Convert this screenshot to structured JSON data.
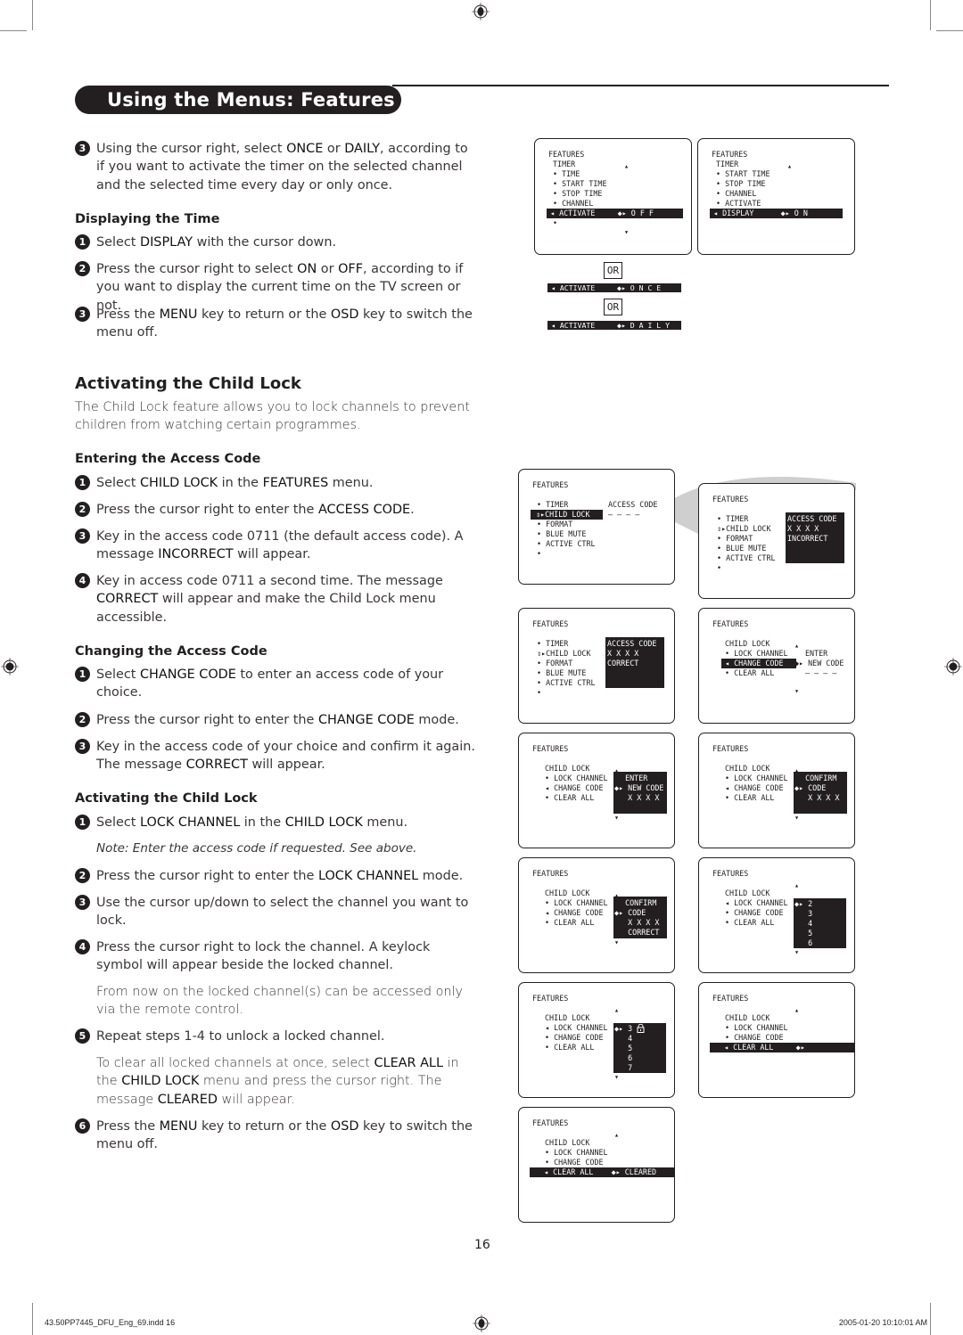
{
  "page": {
    "title": "Using the Menus: Features",
    "page_number": "16",
    "footer_left": "43.50PP7445_DFU_Eng_69.indd   16",
    "footer_right": "2005-01-20   10:10:01 AM"
  },
  "intro_step": {
    "num": "3",
    "segments": [
      [
        "Using the cursor right, select ",
        false
      ],
      [
        "ONCE",
        true
      ],
      [
        " or ",
        false
      ],
      [
        "DAILY",
        true
      ],
      [
        ", according to if you want to activate the timer on the selected channel and the selected time every day or only once.",
        false
      ]
    ]
  },
  "displaying_time": {
    "heading": "Displaying the Time",
    "steps": [
      {
        "num": "1",
        "segments": [
          [
            "Select ",
            false
          ],
          [
            "DISPLAY",
            true
          ],
          [
            " with the cursor down.",
            false
          ]
        ]
      },
      {
        "num": "2",
        "segments": [
          [
            "Press the cursor right to select ",
            false
          ],
          [
            "ON",
            true
          ],
          [
            " or ",
            false
          ],
          [
            "OFF",
            true
          ],
          [
            ", according to if you want to display the current time on the TV screen or not.",
            false
          ]
        ]
      },
      {
        "num": "3",
        "segments": [
          [
            "Press the ",
            false
          ],
          [
            "MENU",
            true
          ],
          [
            " key to return or the ",
            false
          ],
          [
            "OSD",
            true
          ],
          [
            " key to switch the menu off.",
            false
          ]
        ]
      }
    ]
  },
  "child_lock": {
    "heading": "Activating the Child Lock",
    "intro": "The Child Lock feature allows you to lock channels to prevent children from watching certain programmes."
  },
  "entering_code": {
    "heading": "Entering the Access Code",
    "steps": [
      {
        "num": "1",
        "segments": [
          [
            "Select ",
            false
          ],
          [
            "CHILD LOCK",
            true
          ],
          [
            " in the ",
            false
          ],
          [
            "FEATURES",
            true
          ],
          [
            " menu.",
            false
          ]
        ]
      },
      {
        "num": "2",
        "segments": [
          [
            "Press the cursor right to enter the ",
            false
          ],
          [
            "ACCESS CODE",
            true
          ],
          [
            ".",
            false
          ]
        ]
      },
      {
        "num": "3",
        "segments": [
          [
            "Key in the access code 0711 (the default access code). A message ",
            false
          ],
          [
            "INCORRECT",
            true
          ],
          [
            " will appear.",
            false
          ]
        ]
      },
      {
        "num": "4",
        "segments": [
          [
            "Key in access code 0711 a second time. The message ",
            false
          ],
          [
            "CORRECT",
            true
          ],
          [
            " will appear and make the Child Lock menu accessible.",
            false
          ]
        ]
      }
    ]
  },
  "changing_code": {
    "heading": "Changing the Access Code",
    "steps": [
      {
        "num": "1",
        "segments": [
          [
            "Select ",
            false
          ],
          [
            "CHANGE CODE",
            true
          ],
          [
            " to enter an access code of your choice.",
            false
          ]
        ]
      },
      {
        "num": "2",
        "segments": [
          [
            "Press the cursor right to enter the ",
            false
          ],
          [
            "CHANGE CODE",
            true
          ],
          [
            " mode.",
            false
          ]
        ]
      },
      {
        "num": "3",
        "segments": [
          [
            "Key in the access code of your choice and confirm it again. The message ",
            false
          ],
          [
            "CORRECT",
            true
          ],
          [
            " will appear.",
            false
          ]
        ]
      }
    ]
  },
  "activating_lock": {
    "heading": "Activating the Child Lock",
    "step1": {
      "num": "1",
      "segments": [
        [
          "Select ",
          false
        ],
        [
          "LOCK CHANNEL",
          true
        ],
        [
          " in the ",
          false
        ],
        [
          "CHILD LOCK",
          true
        ],
        [
          " menu.",
          false
        ]
      ]
    },
    "note": "Note: Enter the access code if requested. See above.",
    "steps": [
      {
        "num": "2",
        "segments": [
          [
            "Press the cursor right to enter the ",
            false
          ],
          [
            "LOCK CHANNEL",
            true
          ],
          [
            " mode.",
            false
          ]
        ]
      },
      {
        "num": "3",
        "segments": [
          [
            "Use the cursor up/down to select the channel you want to lock.",
            false
          ]
        ]
      },
      {
        "num": "4",
        "segments": [
          [
            "Press the cursor right to lock the channel. A keylock symbol will appear beside the locked channel.",
            false
          ]
        ]
      }
    ],
    "para1": "From now on the locked channel(s) can be accessed only via the remote control.",
    "step5": {
      "num": "5",
      "segments": [
        [
          "Repeat steps 1-4 to unlock a locked channel.",
          false
        ]
      ]
    },
    "para2": [
      [
        "To clear all locked channels at once, select ",
        false
      ],
      [
        "CLEAR ALL",
        true
      ],
      [
        " in the ",
        false
      ],
      [
        "CHILD LOCK",
        true
      ],
      [
        " menu and press the cursor right. The message ",
        false
      ],
      [
        "CLEARED",
        true
      ],
      [
        " will appear.",
        false
      ]
    ],
    "step6": {
      "num": "6",
      "segments": [
        [
          "Press the ",
          false
        ],
        [
          "MENU",
          true
        ],
        [
          " key to return or the ",
          false
        ],
        [
          "OSD",
          true
        ],
        [
          " key to switch the menu off.",
          false
        ]
      ]
    }
  },
  "osd": {
    "features_label": "FEATURES",
    "timer_off": {
      "rows": [
        "TIMER",
        "• TIME",
        "• START TIME",
        "• STOP TIME",
        "• CHANNEL"
      ],
      "highlight": "◂ ACTIVATE     ◆▸ O F F",
      "after": "•"
    },
    "timer_display": {
      "rows": [
        "TIMER",
        "• START TIME",
        "• STOP TIME",
        "• CHANNEL",
        "• ACTIVATE"
      ],
      "highlight": "◂ DISPLAY      ◆▸ O N"
    },
    "or_label": "OR",
    "activate_once": "◂ ACTIVATE     ◆▸ O N C E",
    "activate_daily": "◂ ACTIVATE     ◆▸ D A I L Y",
    "access_blank": {
      "rows": [
        "• TIMER",
        "• FORMAT",
        "• BLUE MUTE",
        "• ACTIVE CTRL",
        "•"
      ],
      "highlight": "⇕▸CHILD LOCK ",
      "side_label": "ACCESS CODE",
      "side_value": "– – – –"
    },
    "access_incorrect": {
      "rows": [
        "• TIMER",
        "⇕▸CHILD LOCK",
        "• FORMAT",
        "• BLUE MUTE",
        "• ACTIVE CTRL",
        "•"
      ],
      "box": [
        "ACCESS CODE",
        "X X X X",
        "INCORRECT"
      ]
    },
    "access_correct": {
      "rows": [
        "• TIMER",
        "⇕▸CHILD LOCK",
        "• FORMAT",
        "• BLUE MUTE",
        "• ACTIVE CTRL",
        "•"
      ],
      "box": [
        "ACCESS CODE",
        "X X X X",
        "CORRECT"
      ]
    },
    "change_code": {
      "rows": [
        "CHILD LOCK",
        "• LOCK CHANNEL",
        "",
        "• CLEAR ALL"
      ],
      "highlight": "◂ CHANGE CODE ",
      "side": [
        "ENTER",
        "◆▸ NEW CODE",
        "– – – –"
      ]
    },
    "child_rows": [
      "CHILD LOCK",
      "• LOCK CHANNEL",
      "◂ CHANGE CODE",
      "• CLEAR ALL"
    ],
    "enter_new": [
      "  ENTER",
      "◆▸ NEW CODE",
      "   X X X X"
    ],
    "confirm_code": [
      "  CONFIRM",
      "◆▸ CODE",
      "   X X X X"
    ],
    "confirm_correct": [
      "  CONFIRM",
      "◆▸ CODE",
      "   X X X X",
      "   CORRECT"
    ],
    "lock_rows": [
      "CHILD LOCK",
      "◂ LOCK CHANNEL",
      "• CHANGE CODE",
      "• CLEAR ALL"
    ],
    "channels_a": [
      "◆▸ 2",
      "   3",
      "   4",
      "   5",
      "   6"
    ],
    "channels_b": [
      "◆▸ 3",
      "   4",
      "   5",
      "   6",
      "   7"
    ],
    "clear_rows": [
      "CHILD LOCK",
      "• LOCK CHANNEL",
      "• CHANGE CODE"
    ],
    "clear_highlight": "◂ CLEAR ALL     ◆▸",
    "cleared_highlight": "◂ CLEAR ALL    ◆▸ CLEARED",
    "up_arrow": "▴",
    "down_arrow": "▾",
    "lock_symbol": "🔒"
  }
}
